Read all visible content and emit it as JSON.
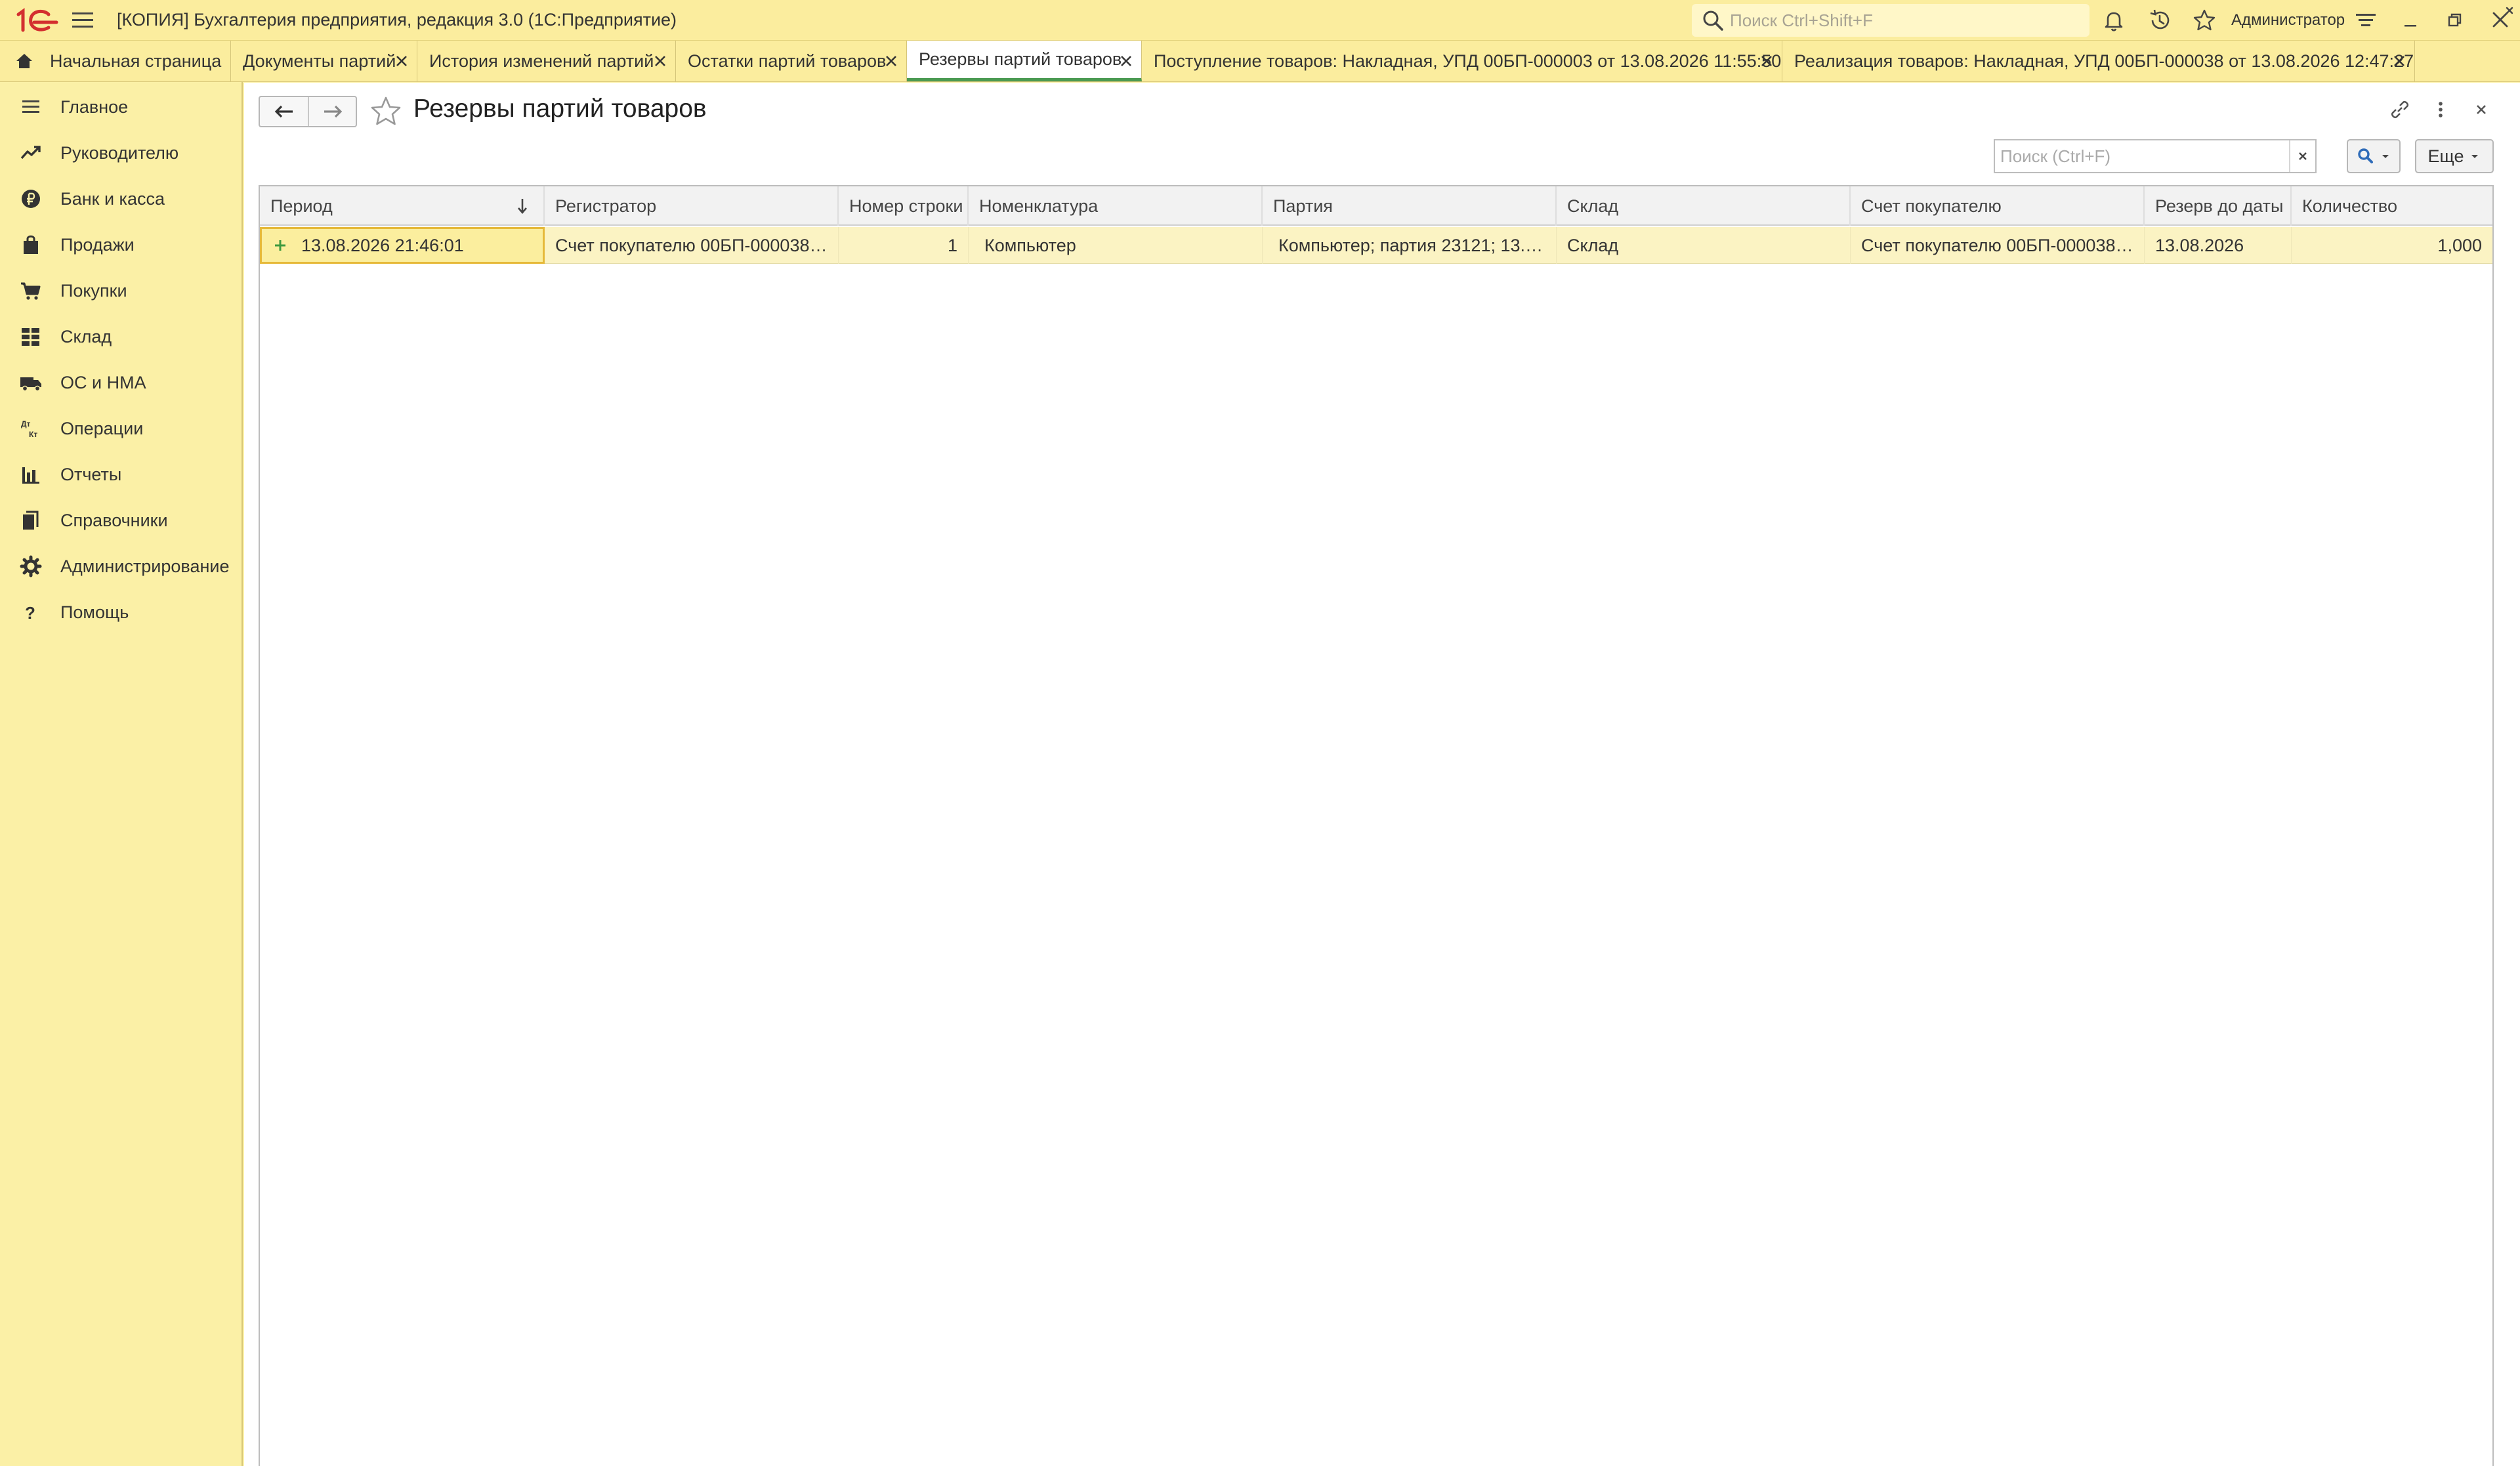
{
  "window": {
    "title": "[КОПИЯ] Бухгалтерия предприятия, редакция 3.0  (1С:Предприятие)",
    "search_placeholder": "Поиск Ctrl+Shift+F",
    "user": "Администратор"
  },
  "tabs": [
    {
      "label": "Начальная страница",
      "closable": false
    },
    {
      "label": "Документы партий",
      "closable": true
    },
    {
      "label": "История изменений партий",
      "closable": true
    },
    {
      "label": "Остатки партий товаров",
      "closable": true
    },
    {
      "label": "Резервы партий товаров",
      "closable": true,
      "active": true
    },
    {
      "label": "Поступление товаров: Накладная, УПД 00БП-000003 от 13.08.2026 11:55:50",
      "closable": true
    },
    {
      "label": "Реализация товаров: Накладная, УПД 00БП-000038 от 13.08.2026 12:47:27",
      "closable": true
    }
  ],
  "sidebar": {
    "items": [
      {
        "label": "Главное",
        "icon": "hamburger-icon"
      },
      {
        "label": "Руководителю",
        "icon": "trend-icon"
      },
      {
        "label": "Банк и касса",
        "icon": "ruble-icon"
      },
      {
        "label": "Продажи",
        "icon": "shopping-bag-icon"
      },
      {
        "label": "Покупки",
        "icon": "cart-icon"
      },
      {
        "label": "Склад",
        "icon": "warehouse-icon"
      },
      {
        "label": "ОС и НМА",
        "icon": "truck-icon"
      },
      {
        "label": "Операции",
        "icon": "dt-kt-icon"
      },
      {
        "label": "Отчеты",
        "icon": "bar-chart-icon"
      },
      {
        "label": "Справочники",
        "icon": "books-icon"
      },
      {
        "label": "Администрирование",
        "icon": "gear-icon"
      },
      {
        "label": "Помощь",
        "icon": "help-icon"
      }
    ]
  },
  "form": {
    "title": "Резервы партий товаров",
    "search_placeholder": "Поиск (Ctrl+F)",
    "more_label": "Еще"
  },
  "table": {
    "columns": [
      "Период",
      "Регистратор",
      "Номер строки",
      "Номенклатура",
      "Партия",
      "Склад",
      "Счет покупателю",
      "Резерв до даты",
      "Количество"
    ],
    "rows": [
      [
        "13.08.2026 21:46:01",
        "Счет покупателю 00БП-000038 ...",
        "1",
        "Компьютер",
        "Компьютер; партия 23121; 13.0...",
        "Склад",
        "Счет покупателю 00БП-000038 ...",
        "13.08.2026",
        "1,000"
      ]
    ]
  }
}
